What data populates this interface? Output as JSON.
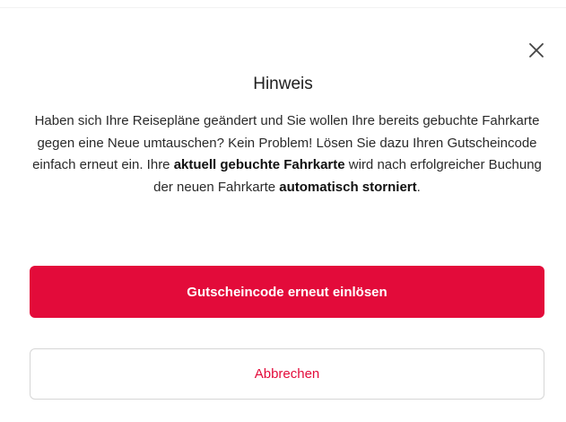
{
  "dialog": {
    "title": "Hinweis",
    "close_icon": "close-icon",
    "message": {
      "part1": "Haben sich Ihre Reisepläne geändert und Sie wollen Ihre bereits gebuchte Fahrkarte gegen eine Neue umtauschen? Kein Problem! Lösen Sie dazu Ihren Gutscheincode einfach erneut ein. Ihre ",
      "bold1": "aktuell gebuchte Fahrkarte",
      "part2": " wird nach erfolgreicher Buchung der neuen Fahrkarte ",
      "bold2": "automatisch storniert",
      "part3": "."
    },
    "primary_button_label": "Gutscheincode erneut einlösen",
    "secondary_button_label": "Abbrechen"
  },
  "colors": {
    "accent": "#e30b3a",
    "text": "#222222",
    "border": "#d6d6d6"
  }
}
